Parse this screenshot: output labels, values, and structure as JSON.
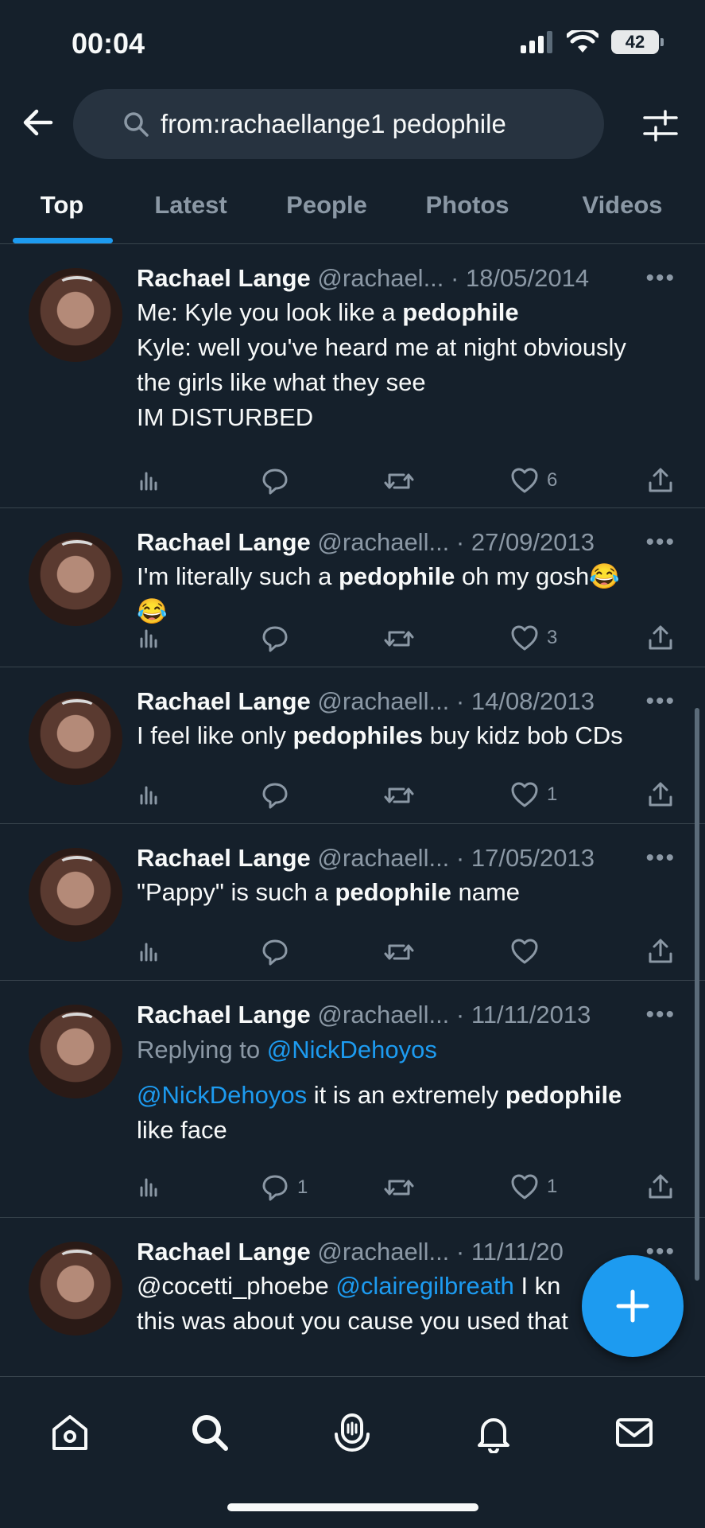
{
  "status": {
    "time": "00:04",
    "battery": "42"
  },
  "search": {
    "query": "from:rachaellange1 pedophile"
  },
  "tabs": [
    {
      "label": "Top",
      "active": true
    },
    {
      "label": "Latest"
    },
    {
      "label": "People"
    },
    {
      "label": "Photos"
    },
    {
      "label": "Videos"
    }
  ],
  "tweets": [
    {
      "name": "Rachael Lange",
      "handle": "@rachael...",
      "date": "· 18/05/2014",
      "lines": [
        [
          "Me: Kyle you look like a ",
          {
            "b": "pedophile"
          }
        ],
        [
          "Kyle: well you've heard me at night obviously"
        ],
        [
          "the girls like what they see"
        ],
        [
          "IM DISTURBED"
        ]
      ],
      "replies": "",
      "retweets": "",
      "likes": "6"
    },
    {
      "name": "Rachael Lange",
      "handle": "@rachaell...",
      "date": "· 27/09/2013",
      "lines": [
        [
          "I'm literally such a ",
          {
            "b": "pedophile"
          },
          " oh my gosh😂"
        ],
        [
          "😂"
        ]
      ],
      "replies": "",
      "retweets": "",
      "likes": "3"
    },
    {
      "name": "Rachael Lange",
      "handle": "@rachaell...",
      "date": "· 14/08/2013",
      "lines": [
        [
          "I feel like only ",
          {
            "b": "pedophiles"
          },
          " buy kidz bob CDs"
        ]
      ],
      "replies": "",
      "retweets": "",
      "likes": "1"
    },
    {
      "name": "Rachael Lange",
      "handle": "@rachaell...",
      "date": "· 17/05/2013",
      "lines": [
        [
          "\"Pappy\" is such a ",
          {
            "b": "pedophile"
          },
          " name"
        ]
      ],
      "replies": "",
      "retweets": "",
      "likes": ""
    },
    {
      "name": "Rachael Lange",
      "handle": "@rachaell...",
      "date": "· 11/11/2013",
      "reply_to_prefix": "Replying to ",
      "reply_to": "@NickDehoyos",
      "lines": [
        [
          {
            "m": "@NickDehoyos"
          },
          " it is an extremely ",
          {
            "b": "pedophile"
          }
        ],
        [
          "like face"
        ]
      ],
      "replies": "1",
      "retweets": "",
      "likes": "1"
    },
    {
      "name": "Rachael Lange",
      "handle": "@rachaell...",
      "date": "· 11/11/20",
      "lines": [
        [
          "@cocetti_phoebe ",
          {
            "m": "@clairegilbreath"
          },
          " I kn"
        ],
        [
          "this was about you cause you used that"
        ]
      ],
      "replies": "",
      "retweets": "",
      "likes": "",
      "partial": true
    }
  ],
  "icons": {
    "back": "back-arrow-icon",
    "search": "search-icon",
    "filter": "filter-icon",
    "views": "views-icon",
    "reply": "reply-icon",
    "retweet": "retweet-icon",
    "like": "like-icon",
    "share": "share-icon",
    "more": "more-icon",
    "compose": "compose-plus-icon",
    "home": "home-icon",
    "explore": "search-icon",
    "spaces": "spaces-icon",
    "notifications": "bell-icon",
    "messages": "mail-icon"
  },
  "colors": {
    "background": "#15202b",
    "accent": "#1d9bf0",
    "muted": "#8b98a5",
    "divider": "#38444d"
  }
}
